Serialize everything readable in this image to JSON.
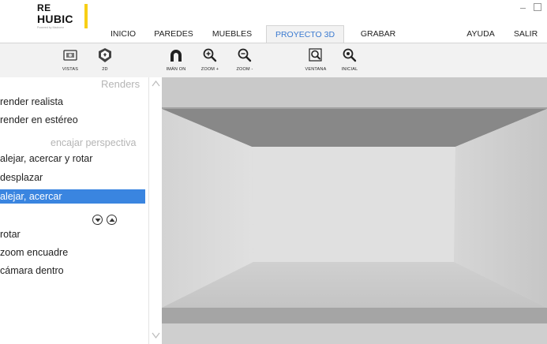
{
  "logo": {
    "line1": "RE",
    "line2": "HUBIC",
    "tagline": "Powered by Madrome",
    "accent": "#f7cf16"
  },
  "nav": {
    "items": [
      {
        "label": "INICIO",
        "active": false
      },
      {
        "label": "PAREDES",
        "active": false
      },
      {
        "label": "MUEBLES",
        "active": false
      },
      {
        "label": "PROYECTO 3D",
        "active": true
      },
      {
        "label": "GRABAR",
        "active": false
      },
      {
        "label": "AYUDA",
        "active": false
      },
      {
        "label": "SALIR",
        "active": false
      }
    ],
    "active_color": "#3b7ad0"
  },
  "toolbar": {
    "tools": [
      {
        "label": "VISTAS",
        "icon": "views-icon"
      },
      {
        "label": "2D",
        "icon": "2d-view-icon"
      },
      {
        "label": "IMÁN ON",
        "icon": "magnet-icon"
      },
      {
        "label": "ZOOM +",
        "icon": "zoom-in-icon"
      },
      {
        "label": "ZOOM -",
        "icon": "zoom-out-icon"
      },
      {
        "label": "VENTANA",
        "icon": "zoom-window-icon"
      },
      {
        "label": "INICIAL",
        "icon": "zoom-initial-icon"
      }
    ]
  },
  "sidebar": {
    "renders_header": "Renders",
    "render_items": [
      "render realista",
      "render en estéreo"
    ],
    "perspective_header": "encajar perspectiva",
    "perspective_items": [
      "alejar, acercar y rotar",
      "desplazar",
      "alejar, acercar"
    ],
    "selected_item": "alejar, acercar",
    "camera_items": [
      "rotar",
      "zoom encuadre",
      "cámara dentro"
    ],
    "selected_color": "#3a85e0"
  }
}
